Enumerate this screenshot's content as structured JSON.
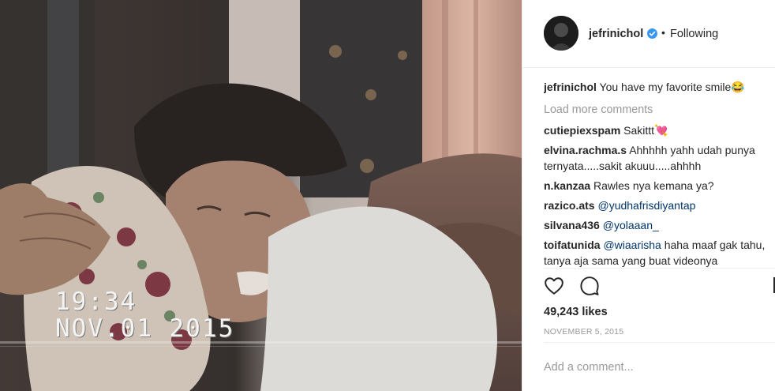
{
  "post": {
    "username": "jefrinichol",
    "follow_status": "Following",
    "dot": "•",
    "caption": {
      "user": "jefrinichol",
      "text": "You have my favorite smile😂"
    },
    "load_more": "Load more comments",
    "comments": [
      {
        "user": "cutiepiexspam",
        "text": "Sakittt💘"
      },
      {
        "user": "elvina.rachma.s",
        "text": "Ahhhhh yahh udah punya ternyata.....sakit akuuu.....ahhhh"
      },
      {
        "user": "n.kanzaa",
        "text": "Rawles nya kemana ya?"
      },
      {
        "user": "razico.ats",
        "mention": "@yudhafrisdiyantap"
      },
      {
        "user": "silvana436",
        "mention": "@yolaaan_"
      },
      {
        "user": "toifatunida",
        "mention": "@wiaarisha",
        "text": "haha maaf gak tahu, tanya aja sama yang buat videonya"
      }
    ],
    "likes": "49,243 likes",
    "date": "NOVEMBER 5, 2015",
    "add_comment_placeholder": "Add a comment..."
  },
  "media": {
    "timestamp_time": "19:34",
    "timestamp_date": "NOV.01 2015"
  },
  "icons": {
    "avatar": "profile-photo",
    "verified": "verified-badge-icon",
    "like": "heart-icon",
    "comment": "comment-bubble-icon"
  },
  "colors": {
    "verified": "#3897f0",
    "mention": "#003569",
    "muted": "#999999",
    "text": "#262626"
  }
}
